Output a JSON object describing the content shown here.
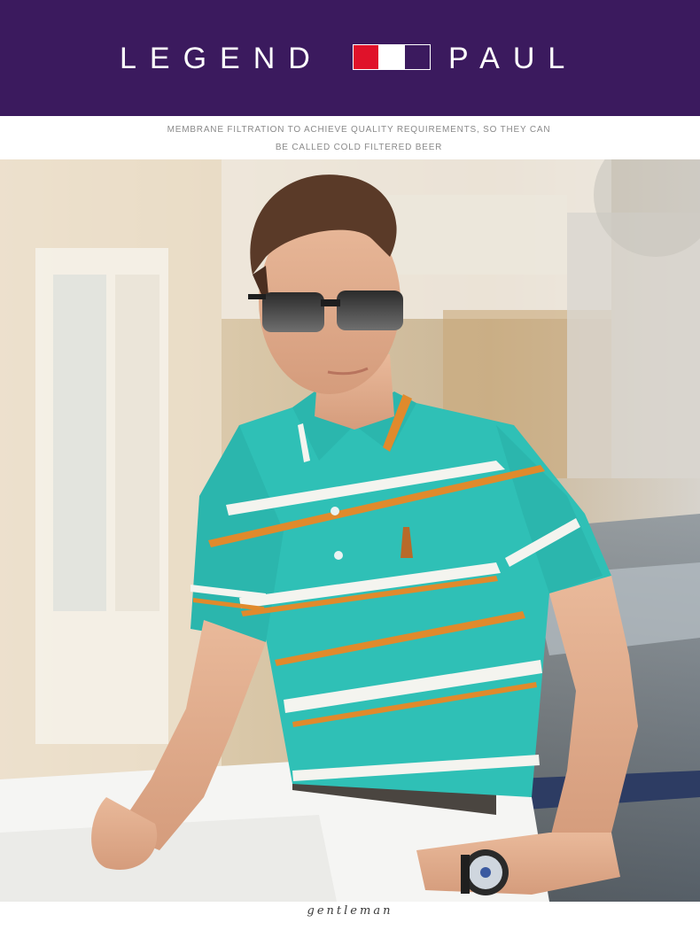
{
  "header": {
    "brand_left": "LEGEND",
    "brand_right": "PAUL",
    "background_color": "#3b1a5e",
    "flag_colors": [
      "#e0122a",
      "#ffffff",
      "#3b1a5e"
    ]
  },
  "subtitle": {
    "line1": "MEMBRANE FILTRATION TO ACHIEVE QUALITY REQUIREMENTS, SO THEY CAN",
    "line2": "BE CALLED COLD FILTERED BEER"
  },
  "photo": {
    "shirt_color": "#2fc0b6",
    "stripe_orange": "#e08a2c",
    "stripe_white": "#f4f4ef"
  },
  "footer": {
    "caption": "gentleman"
  }
}
